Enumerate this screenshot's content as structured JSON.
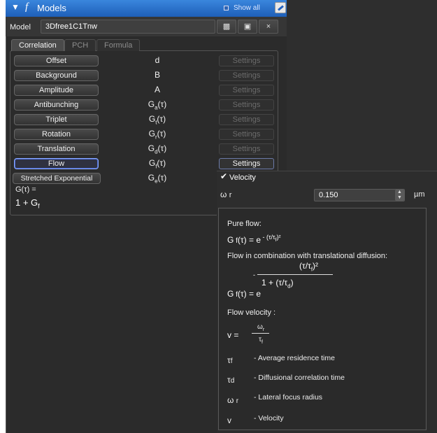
{
  "titlebar": {
    "fn_symbol": "f",
    "title": "Models",
    "show_all_label": "Show all"
  },
  "model": {
    "label": "Model",
    "name": "3Dfree1C1Tnw",
    "open_icon": "folder-open-icon",
    "save_icon": "save-icon",
    "close_label": "×"
  },
  "tabs": [
    {
      "label": "Correlation",
      "active": true
    },
    {
      "label": "PCH",
      "active": false
    },
    {
      "label": "Formula",
      "active": false
    }
  ],
  "components": [
    {
      "name": "Offset",
      "symbol": "d",
      "settings": "Settings",
      "enabled": false
    },
    {
      "name": "Background",
      "symbol": "B",
      "settings": "Settings",
      "enabled": false
    },
    {
      "name": "Amplitude",
      "symbol": "A",
      "settings": "Settings",
      "enabled": false
    },
    {
      "name": "Antibunching",
      "symbol": "Ga(τ)",
      "settings": "Settings",
      "enabled": false
    },
    {
      "name": "Triplet",
      "symbol": "Gt(τ)",
      "settings": "Settings",
      "enabled": false
    },
    {
      "name": "Rotation",
      "symbol": "Gr(τ)",
      "settings": "Settings",
      "enabled": false
    },
    {
      "name": "Translation",
      "symbol": "Gd(τ)",
      "settings": "Settings",
      "enabled": true
    },
    {
      "name": "Flow",
      "symbol": "Gf(τ)",
      "settings": "Settings",
      "enabled": true,
      "selected": true
    },
    {
      "name": "Stretched Exponential",
      "symbol": "Ge(τ)",
      "settings": "",
      "enabled": false
    }
  ],
  "formula": {
    "label": "G(τ) =",
    "expr": "1 + Gf"
  },
  "flow_settings": {
    "velocity_label": "Velocity",
    "velocity_checked": true,
    "omega_label": "ω r",
    "omega_value": "0.150",
    "unit": "µm",
    "pure_flow_title": "Pure flow:",
    "pure_flow_lhs": "G f(τ) =",
    "pure_flow_rhs": "e",
    "pure_flow_exp": "- (τ/τf)²",
    "combo_title": "Flow in combination with translational diffusion:",
    "combo_numerator": "(τ/τf)²",
    "combo_lhs": "G f(τ) = e",
    "combo_denominator": "1 + (τ/τd)",
    "velocity_title": "Flow velocity :",
    "v_lhs": "v =",
    "v_numerator": "ωr",
    "v_denominator": "τf",
    "legend": [
      {
        "sym": "τf",
        "text": "- Average residence time"
      },
      {
        "sym": "τd",
        "text": "- Diffusional correlation time"
      },
      {
        "sym": "ω r",
        "text": "- Lateral focus radius"
      },
      {
        "sym": "v",
        "text": "- Velocity"
      }
    ]
  }
}
